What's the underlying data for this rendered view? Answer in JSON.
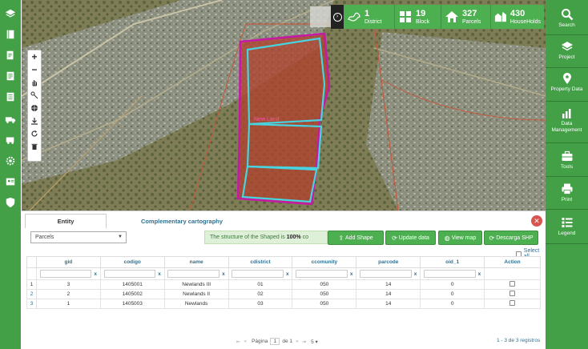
{
  "stats": [
    {
      "value": "1",
      "label": "District",
      "icon": "district-map-icon"
    },
    {
      "value": "19",
      "label": "Block",
      "icon": "block-grid-icon"
    },
    {
      "value": "327",
      "label": "Parcels",
      "icon": "parcel-house-icon"
    },
    {
      "value": "430",
      "label": "HouseHolds",
      "icon": "households-icon"
    }
  ],
  "map": {
    "zoom_in": "+",
    "zoom_out": "−",
    "parcel_label": "New Land"
  },
  "right_menu": [
    {
      "label": "Search",
      "icon": "search-icon"
    },
    {
      "label": "Project",
      "icon": "layers-icon"
    },
    {
      "label": "Property Data",
      "icon": "map-pin-icon"
    },
    {
      "label": "Data Management",
      "icon": "bar-chart-icon"
    },
    {
      "label": "Tools",
      "icon": "toolbox-icon"
    },
    {
      "label": "Print",
      "icon": "printer-icon"
    },
    {
      "label": "Legend",
      "icon": "list-icon"
    }
  ],
  "panel": {
    "tabs": [
      "Entity",
      "Complementary cartography"
    ],
    "close_label": "✕",
    "select_value": "Parcels",
    "alert_prefix": "The structure of the Shaped is ",
    "alert_bold": "100%",
    "alert_suffix": " co",
    "buttons": {
      "add_shape": "Add Shape",
      "update_data": "Update data",
      "view_map": "View map",
      "download_shp": "Descarga SHP"
    },
    "select_all": "Select all",
    "columns": [
      "gid",
      "codigo",
      "name",
      "cdistrict",
      "ccomunity",
      "parcode",
      "oid_1",
      "Action"
    ],
    "filter_clear": "x",
    "rows": [
      {
        "n": "1",
        "gid": "3",
        "codigo": "1405001",
        "name": "Newlands III",
        "cdistrict": "01",
        "ccomunity": "050",
        "parcode": "14",
        "oid_1": "0"
      },
      {
        "n": "2",
        "gid": "2",
        "codigo": "1405002",
        "name": "Newlands II",
        "cdistrict": "02",
        "ccomunity": "050",
        "parcode": "14",
        "oid_1": "0"
      },
      {
        "n": "3",
        "gid": "1",
        "codigo": "1405003",
        "name": "Newlands",
        "cdistrict": "03",
        "ccomunity": "050",
        "parcode": "14",
        "oid_1": "0"
      }
    ],
    "pager": {
      "page_label": "Página",
      "page_value": "1",
      "of_label": "de 1",
      "page_size": "5"
    },
    "records": "1 - 3 de 3 registros"
  }
}
